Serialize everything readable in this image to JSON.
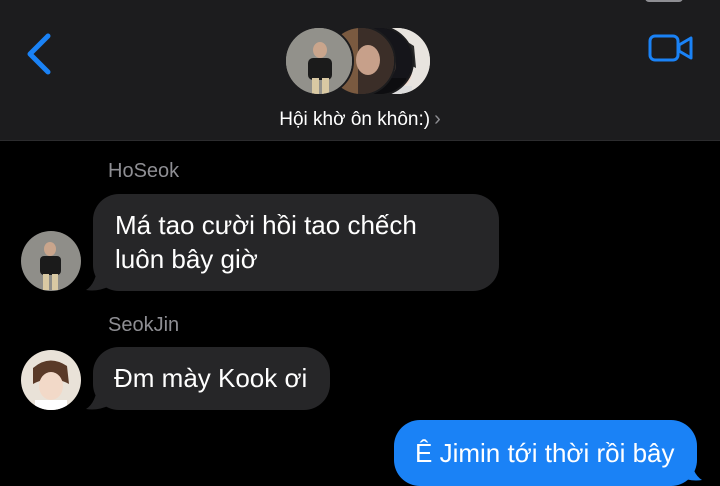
{
  "header": {
    "group_name": "Hội khờ ôn khôn:)",
    "chevron": "›",
    "icons": [
      "chevron-left-icon",
      "video-camera-icon"
    ],
    "accent": "#1a82f6"
  },
  "messages": [
    {
      "sender": "HoSeok",
      "lines": [
        "Má tao cười hồi tao chếch",
        "luôn bây giờ"
      ]
    },
    {
      "sender": "SeokJin",
      "lines": [
        "Đm mày Kook ơi"
      ]
    },
    {
      "outgoing_text": "Ê Jimin tới thời rồi bây"
    }
  ],
  "colors": {
    "incoming_bubble": "#262628",
    "outgoing_bubble": "#1a82f6",
    "header_bg": "#1c1c1e",
    "background": "#000000"
  }
}
